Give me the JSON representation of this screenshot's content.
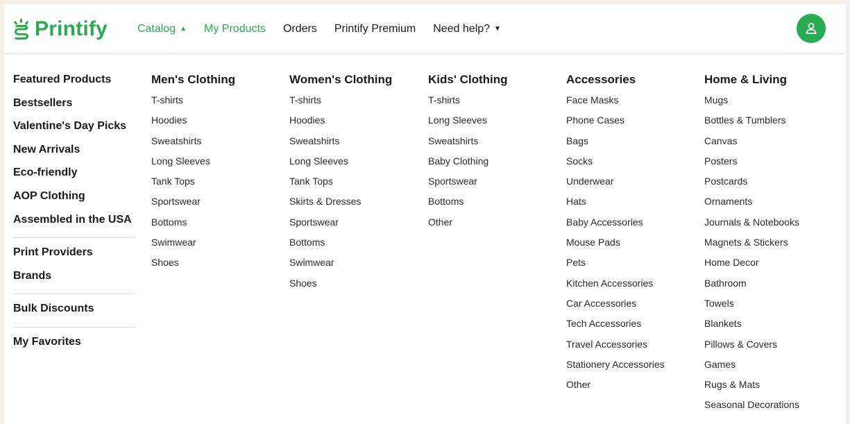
{
  "brand": {
    "name": "Printify",
    "color": "#29ab51"
  },
  "topnav": [
    {
      "label": "Catalog",
      "caret": "up",
      "active": true
    },
    {
      "label": "My Products",
      "active": true
    },
    {
      "label": "Orders"
    },
    {
      "label": "Printify Premium"
    },
    {
      "label": "Need help?",
      "caret": "down"
    }
  ],
  "avatar": {
    "icon": "user-icon"
  },
  "menu": {
    "left": {
      "group1": [
        "Featured Products",
        "Bestsellers",
        "Valentine's Day Picks",
        "New Arrivals",
        "Eco-friendly",
        "AOP Clothing",
        "Assembled in the USA"
      ],
      "group2": [
        "Print Providers",
        "Brands"
      ],
      "group3": [
        "Bulk Discounts"
      ],
      "group4": [
        "My Favorites"
      ]
    },
    "columns": [
      {
        "title": "Men's Clothing",
        "items": [
          "T-shirts",
          "Hoodies",
          "Sweatshirts",
          "Long Sleeves",
          "Tank Tops",
          "Sportswear",
          "Bottoms",
          "Swimwear",
          "Shoes"
        ]
      },
      {
        "title": "Women's Clothing",
        "items": [
          "T-shirts",
          "Hoodies",
          "Sweatshirts",
          "Long Sleeves",
          "Tank Tops",
          "Skirts & Dresses",
          "Sportswear",
          "Bottoms",
          "Swimwear",
          "Shoes"
        ]
      },
      {
        "title": "Kids' Clothing",
        "items": [
          "T-shirts",
          "Long Sleeves",
          "Sweatshirts",
          "Baby Clothing",
          "Sportswear",
          "Bottoms",
          "Other"
        ]
      },
      {
        "title": "Accessories",
        "items": [
          "Face Masks",
          "Phone Cases",
          "Bags",
          "Socks",
          "Underwear",
          "Hats",
          "Baby Accessories",
          "Mouse Pads",
          "Pets",
          "Kitchen Accessories",
          "Car Accessories",
          "Tech Accessories",
          "Travel Accessories",
          "Stationery Accessories",
          "Other"
        ]
      },
      {
        "title": "Home & Living",
        "items": [
          "Mugs",
          "Bottles & Tumblers",
          "Canvas",
          "Posters",
          "Postcards",
          "Ornaments",
          "Journals & Notebooks",
          "Magnets & Stickers",
          "Home Decor",
          "Bathroom",
          "Towels",
          "Blankets",
          "Pillows & Covers",
          "Games",
          "Rugs & Mats",
          "Seasonal Decorations"
        ]
      }
    ]
  }
}
